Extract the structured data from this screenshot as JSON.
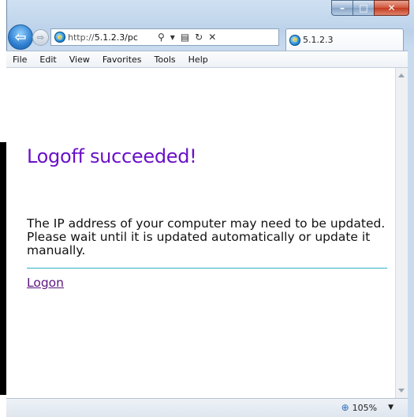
{
  "browser": {
    "address": {
      "url_prefix": "http://",
      "url_host": "5.1.2.3/pc"
    },
    "tab": {
      "title": "5.1.2.3"
    },
    "menu": [
      "File",
      "Edit",
      "View",
      "Favorites",
      "Tools",
      "Help"
    ],
    "zoom": "105%"
  },
  "page": {
    "headline": "Logoff succeeded!",
    "message": "The IP address of your computer may need to be updated. Please wait until it is updated automatically or update it manually.",
    "logon_link": "Logon"
  },
  "colors": {
    "headline": "#6a10c8",
    "link": "#5a157f",
    "divider": "#2bb2c6",
    "close_button": "#c13a1e"
  },
  "icons": [
    "minimize-icon",
    "maximize-icon",
    "close-icon",
    "back-arrow-icon",
    "forward-arrow-icon",
    "ie-logo-icon",
    "search-icon",
    "dropdown-icon",
    "compatibility-icon",
    "refresh-icon",
    "stop-icon",
    "zoom-icon"
  ]
}
